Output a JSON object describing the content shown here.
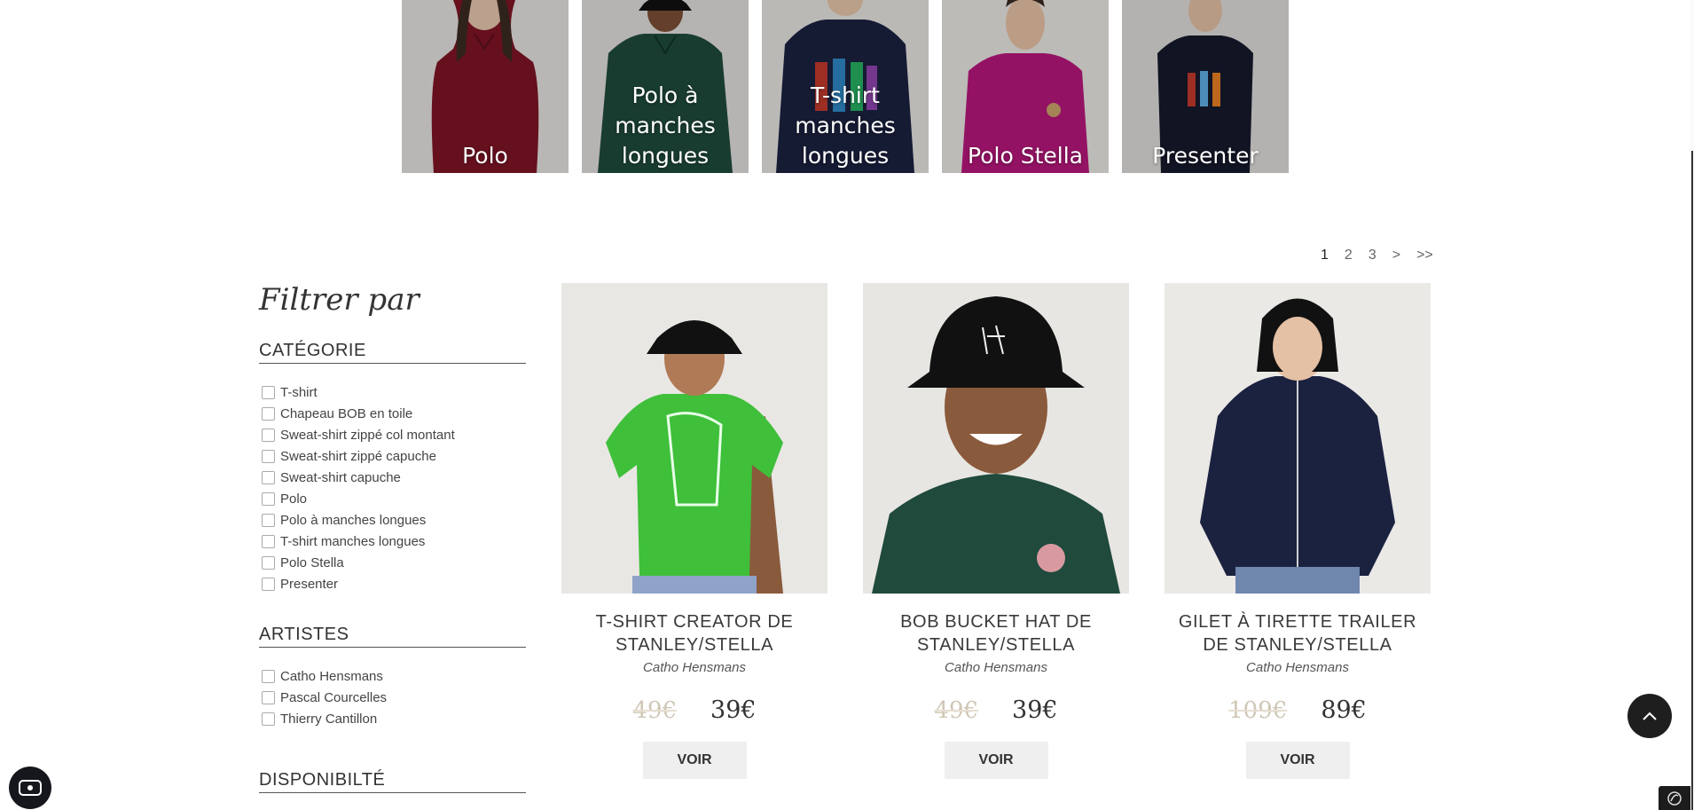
{
  "categories_tiles": [
    {
      "label": "Polo"
    },
    {
      "label": "Polo à manches longues"
    },
    {
      "label": "T-shirt manches longues"
    },
    {
      "label": "Polo Stella"
    },
    {
      "label": "Presenter"
    }
  ],
  "pagination": {
    "pages": [
      "1",
      "2",
      "3"
    ],
    "current": "1",
    "next": ">",
    "last": ">>"
  },
  "sidebar": {
    "title": "Filtrer par",
    "categorie": {
      "title": "CATÉGORIE",
      "items": [
        "T-shirt",
        "Chapeau BOB en toile",
        "Sweat-shirt zippé col montant",
        "Sweat-shirt zippé capuche",
        "Sweat-shirt capuche",
        "Polo",
        "Polo à manches longues",
        "T-shirt manches longues",
        "Polo Stella",
        "Presenter"
      ]
    },
    "artistes": {
      "title": "ARTISTES",
      "items": [
        "Catho Hensmans",
        "Pascal Courcelles",
        "Thierry Cantillon"
      ]
    },
    "disponibilite": {
      "title": "DISPONIBILTÉ"
    }
  },
  "products": [
    {
      "name": "T-shirt Creator de Stanley/Stella",
      "artist": "Catho Hensmans",
      "old_price": "49€",
      "price": "39€",
      "button": "VOIR"
    },
    {
      "name": "BOB Bucket Hat de Stanley/Stella",
      "artist": "Catho Hensmans",
      "old_price": "49€",
      "price": "39€",
      "button": "VOIR"
    },
    {
      "name": "Gilet à tirette Trailer de Stanley/Stella",
      "artist": "Catho Hensmans",
      "old_price": "109€",
      "price": "89€",
      "button": "VOIR"
    }
  ],
  "colors": {
    "tile_bg": "#d8d8d8",
    "polo_red": "#7d1425",
    "polo_green": "#1f4a3c",
    "navy": "#1b2240",
    "fuchsia": "#b5177a",
    "tshirt_green": "#3fbf3a",
    "button_bg": "#efefef",
    "old_price": "#cfc7b6"
  },
  "icons": {
    "scroll_top": "chevron-up-icon",
    "open_widget": "eye-icon",
    "corner": "logo-icon"
  }
}
